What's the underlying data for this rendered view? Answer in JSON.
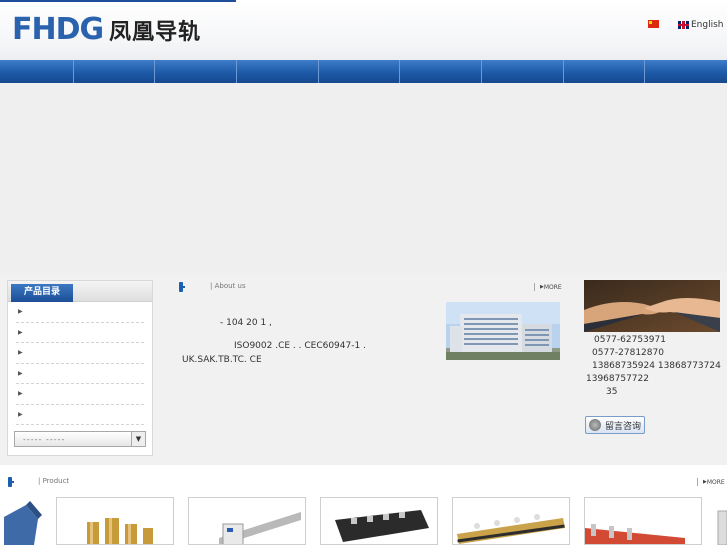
{
  "header": {
    "logo_latin": "FHDG",
    "logo_cn": "凤凰导轨",
    "lang_english": "English"
  },
  "nav": {
    "items": [
      "",
      "",
      "",
      "",
      "",
      "",
      "",
      "",
      ""
    ]
  },
  "sidebar": {
    "title": "产品目录",
    "categories": [
      "",
      "",
      "",
      "",
      "",
      ""
    ],
    "select_text": "-----    -----"
  },
  "about": {
    "title": "| About us",
    "more": "MORE",
    "lines": [
      "-              104       20         1   ,",
      "ISO9002      .CE  .     .   CEC60947-1  .",
      "UK.SAK.TB.TC.       CE"
    ]
  },
  "contact": {
    "tel1": "0577-62753971",
    "tel2": "0577-27812870",
    "mobile1": "13868735924   13868773724",
    "mobile2": "13968757722",
    "addr": "35",
    "message_button": "留言咨询"
  },
  "products": {
    "title": "| Product",
    "more": "MORE"
  },
  "colors": {
    "brand_blue": "#2b62ad",
    "nav_blue": "#1d5aa8"
  }
}
